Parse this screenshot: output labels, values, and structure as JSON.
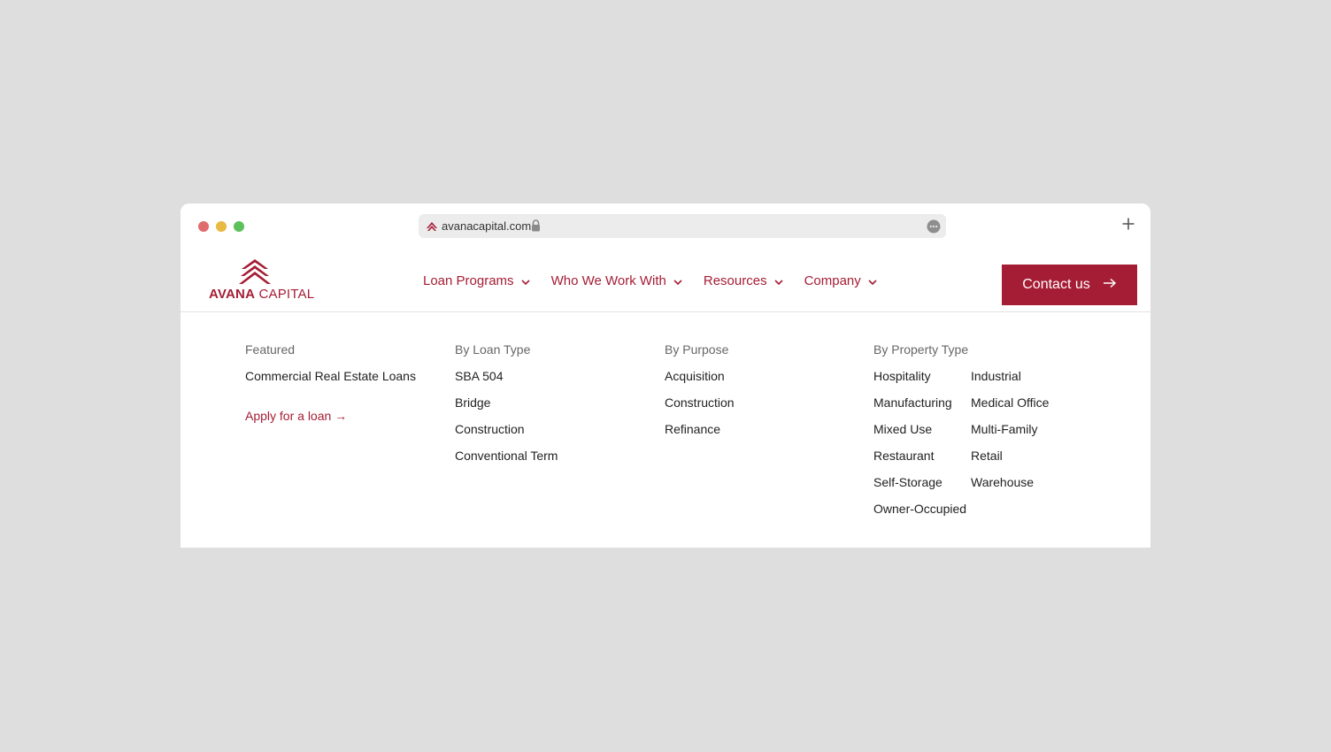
{
  "browser": {
    "url": "avanacapital.com",
    "favicon": "avana-favicon",
    "lock_icon": "lock-icon",
    "more_icon": "more-icon",
    "new_tab_icon": "plus-icon"
  },
  "brand": {
    "name_bold": "AVANA",
    "name_rest": " CAPITAL",
    "color": "#a51d34"
  },
  "nav": {
    "items": [
      {
        "label": "Loan Programs"
      },
      {
        "label": "Who We Work With"
      },
      {
        "label": "Resources"
      },
      {
        "label": "Company"
      }
    ],
    "contact_label": "Contact us"
  },
  "mega": {
    "featured": {
      "heading": "Featured",
      "links": [
        "Commercial Real Estate Loans"
      ],
      "apply_label": "Apply for a loan →"
    },
    "loan_type": {
      "heading": "By Loan Type",
      "links": [
        "SBA 504",
        "Bridge",
        "Construction",
        "Conventional Term"
      ]
    },
    "purpose": {
      "heading": "By Purpose",
      "links": [
        "Acquisition",
        "Construction",
        "Refinance"
      ]
    },
    "property": {
      "heading": "By Property Type",
      "links": [
        "Hospitality",
        "Industrial",
        "Manufacturing",
        "Medical Office",
        "Mixed Use",
        "Multi-Family",
        "Restaurant",
        "Retail",
        "Self-Storage",
        "Warehouse",
        "Owner-Occupied"
      ]
    }
  }
}
